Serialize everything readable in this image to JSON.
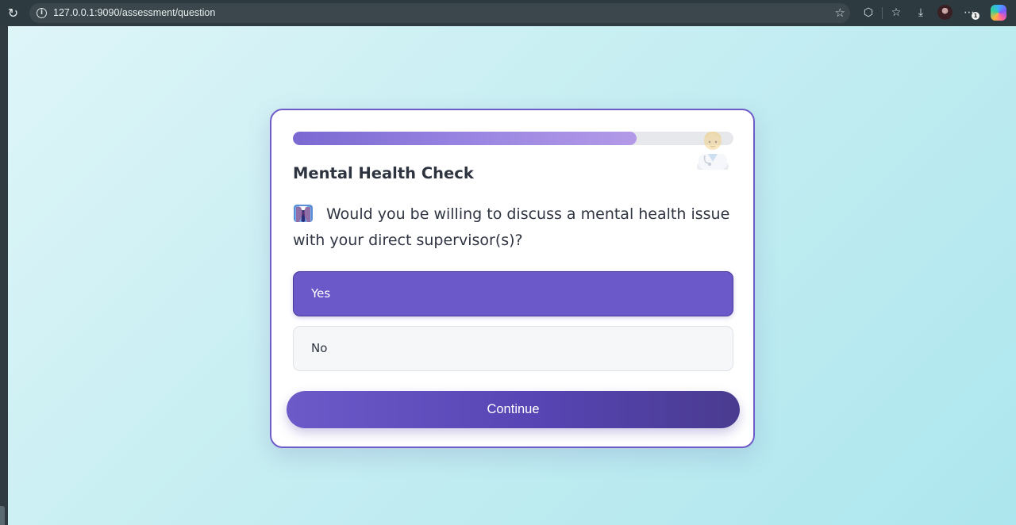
{
  "browser": {
    "url": "127.0.0.1:9090/assessment/question",
    "icons": [
      "reload-icon",
      "site-info-icon",
      "favorite-star-icon",
      "extensions-icon",
      "favorites-icon",
      "download-icon",
      "profile-avatar",
      "more-icon",
      "copilot-icon"
    ]
  },
  "assessment": {
    "title": "Mental Health Check",
    "progress_percent": 78,
    "question_icon": "supervisor-suit-icon",
    "corner_icon": "doctor-icon",
    "question": "Would you be willing to discuss a mental health issue with your direct supervisor(s)?",
    "options": [
      {
        "label": "Yes",
        "selected": true
      },
      {
        "label": "No",
        "selected": false
      }
    ],
    "continue_label": "Continue"
  },
  "colors": {
    "accent": "#6b59c9",
    "progress_fill": "#9b87e2",
    "card_border": "#6f5cc8",
    "background": "#c6eef2"
  }
}
